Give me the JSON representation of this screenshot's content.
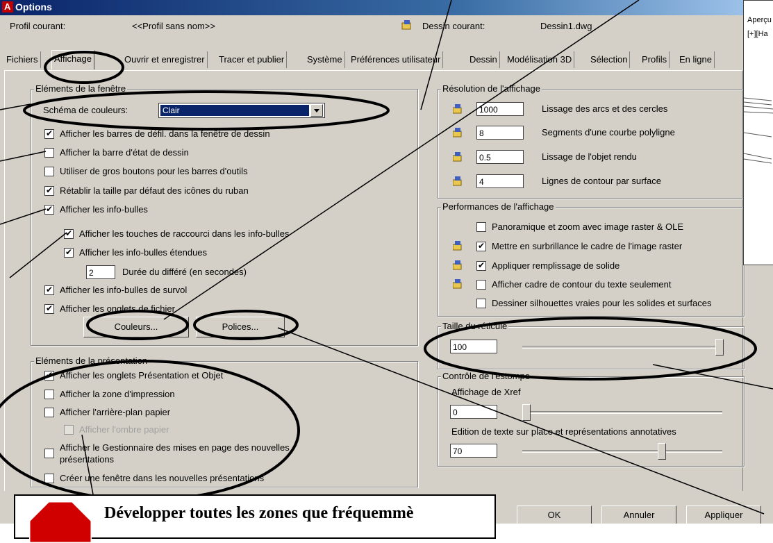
{
  "window": {
    "title": "Options"
  },
  "header": {
    "profile_label": "Profil courant:",
    "profile_value": "<<Profil sans nom>>",
    "drawing_label": "Dessin courant:",
    "drawing_value": "Dessin1.dwg"
  },
  "tabs": [
    "Fichiers",
    "Affichage",
    "Ouvrir et enregistrer",
    "Tracer et publier",
    "Système",
    "Préférences utilisateur",
    "Dessin",
    "Modélisation 3D",
    "Sélection",
    "Profils",
    "En ligne"
  ],
  "window_elements": {
    "group_label": "Eléments de la fenêtre",
    "scheme_label": "Schéma de couleurs:",
    "scheme_value": "Clair",
    "options": [
      {
        "label": "Afficher les barres de défil. dans la fenêtre de dessin",
        "checked": "✔"
      },
      {
        "label": "Afficher la barre d'état de dessin",
        "checked": ""
      },
      {
        "label": "Utiliser de gros boutons pour les barres d'outils",
        "checked": ""
      },
      {
        "label": "Rétablir la taille par défaut des icônes du ruban",
        "checked": "✔"
      },
      {
        "label": "Afficher les info-bulles",
        "checked": "✔"
      },
      {
        "label": "Afficher les touches de raccourci dans les info-bulles",
        "checked": "✔"
      },
      {
        "label": "Afficher les info-bulles étendues",
        "checked": "✔"
      },
      {
        "label": "Afficher les info-bulles de survol",
        "checked": "✔"
      },
      {
        "label": "Afficher les onglets de fichier",
        "checked": "✔"
      }
    ],
    "delay_value": "2",
    "delay_label": "Durée du différé (en secondes)",
    "colors_button": "Couleurs...",
    "fonts_button": "Polices..."
  },
  "layout_elements": {
    "group_label": "Eléments de la présentation",
    "options": [
      {
        "label": "Afficher les onglets Présentation et Objet",
        "checked": "✔"
      },
      {
        "label": "Afficher la zone d'impression",
        "checked": ""
      },
      {
        "label": "Afficher l'arrière-plan papier",
        "checked": ""
      },
      {
        "label": "Afficher l'ombre papier",
        "checked": ""
      },
      {
        "label": "Afficher le Gestionnaire des mises en page des nouvelles",
        "checked": ""
      },
      {
        "label": "Créer une fenêtre dans les nouvelles présentations",
        "checked": ""
      }
    ],
    "option5_line2": "présentations"
  },
  "resolution": {
    "group_label": "Résolution de l'affichage",
    "rows": [
      {
        "value": "1000",
        "label": "Lissage des arcs et des cercles"
      },
      {
        "value": "8",
        "label": "Segments d'une courbe polyligne"
      },
      {
        "value": "0.5",
        "label": "Lissage de l'objet rendu"
      },
      {
        "value": "4",
        "label": "Lignes de contour par surface"
      }
    ]
  },
  "performance": {
    "group_label": "Performances de l'affichage",
    "options": [
      {
        "label": "Panoramique et zoom avec image raster & OLE",
        "checked": ""
      },
      {
        "label": "Mettre en surbrillance le cadre de l'image raster",
        "checked": "✔"
      },
      {
        "label": "Appliquer remplissage de solide",
        "checked": "✔"
      },
      {
        "label": "Afficher cadre de contour du texte seulement",
        "checked": ""
      },
      {
        "label": "Dessiner silhouettes vraies pour les solides et surfaces",
        "checked": ""
      }
    ]
  },
  "crosshair": {
    "group_label": "Taille du réticule",
    "value": "100",
    "level": 100
  },
  "fade": {
    "group_label": "Contrôle de l'estompe",
    "xref_label": "Affichage de Xref",
    "xref_value": "0",
    "xref_level": 0,
    "text_label": "Edition de texte sur place et représentations annotatives",
    "text_value": "70",
    "text_level": 70
  },
  "buttons": {
    "ok": "OK",
    "cancel": "Annuler",
    "apply": "Appliquer"
  },
  "preview": {
    "label": "Aperçu",
    "text": "[+][Ha"
  },
  "callout": {
    "text": "Développer toutes les zones que fréquemmè"
  },
  "colors": {
    "title_start": "#0a246a",
    "annotation": "#000000",
    "scheme_highlight": "#0a246a"
  }
}
